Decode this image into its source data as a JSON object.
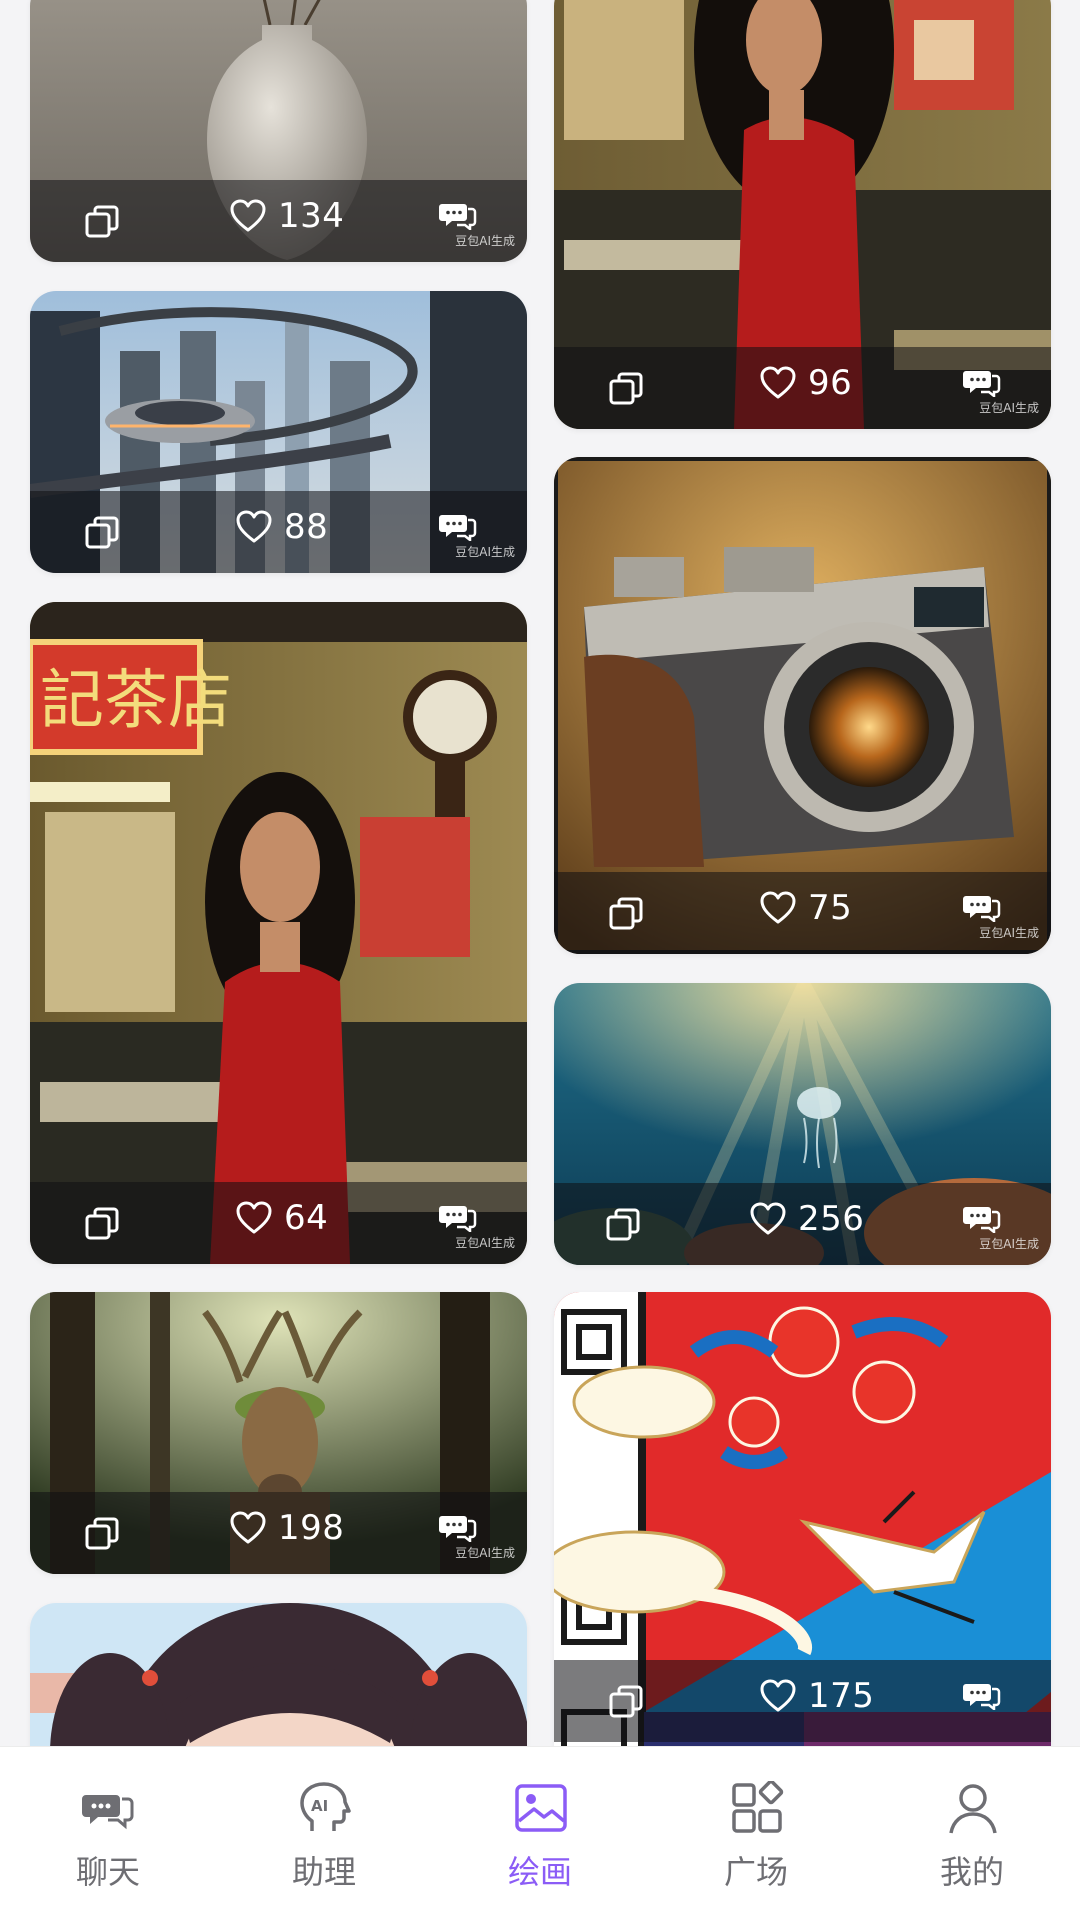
{
  "colors": {
    "accent": "#8b5cf6",
    "tab_inactive": "#6e6e73",
    "background": "#f4f4f6"
  },
  "feed": {
    "left_column": [
      {
        "id": "vase",
        "likes": "134",
        "ai_tag": "豆包AI生成",
        "image": "white ceramic vase with dried branches"
      },
      {
        "id": "city",
        "likes": "88",
        "ai_tag": "豆包AI生成",
        "image": "futuristic city with flying car"
      },
      {
        "id": "teahouse",
        "likes": "64",
        "ai_tag": "豆包AI生成",
        "image": "woman in red dress in retro tea house",
        "sign_text": "記茶店"
      },
      {
        "id": "deer",
        "likes": "198",
        "ai_tag": "豆包AI生成",
        "image": "deer with mossy antlers in sunlit forest"
      },
      {
        "id": "anime",
        "likes": "",
        "ai_tag": "",
        "image": "anime girl with twin tails"
      }
    ],
    "right_column": [
      {
        "id": "woman-red",
        "likes": "96",
        "ai_tag": "豆包AI生成",
        "image": "woman in red dress in restaurant"
      },
      {
        "id": "camera",
        "likes": "75",
        "ai_tag": "豆包AI生成",
        "image": "vintage rangefinder camera with leather case"
      },
      {
        "id": "ocean",
        "likes": "256",
        "ai_tag": "豆包AI生成",
        "image": "underwater scene with jellyfish and coral"
      },
      {
        "id": "crane",
        "likes": "175",
        "ai_tag": "",
        "image": "Chinese style poster with crane, flowers and clouds"
      }
    ]
  },
  "tabbar": {
    "items": [
      {
        "label": "聊天",
        "icon": "chat-bubbles-icon"
      },
      {
        "label": "助理",
        "icon": "ai-head-icon"
      },
      {
        "label": "绘画",
        "icon": "picture-icon",
        "active": true
      },
      {
        "label": "广场",
        "icon": "grid-apps-icon"
      },
      {
        "label": "我的",
        "icon": "person-icon"
      }
    ]
  }
}
